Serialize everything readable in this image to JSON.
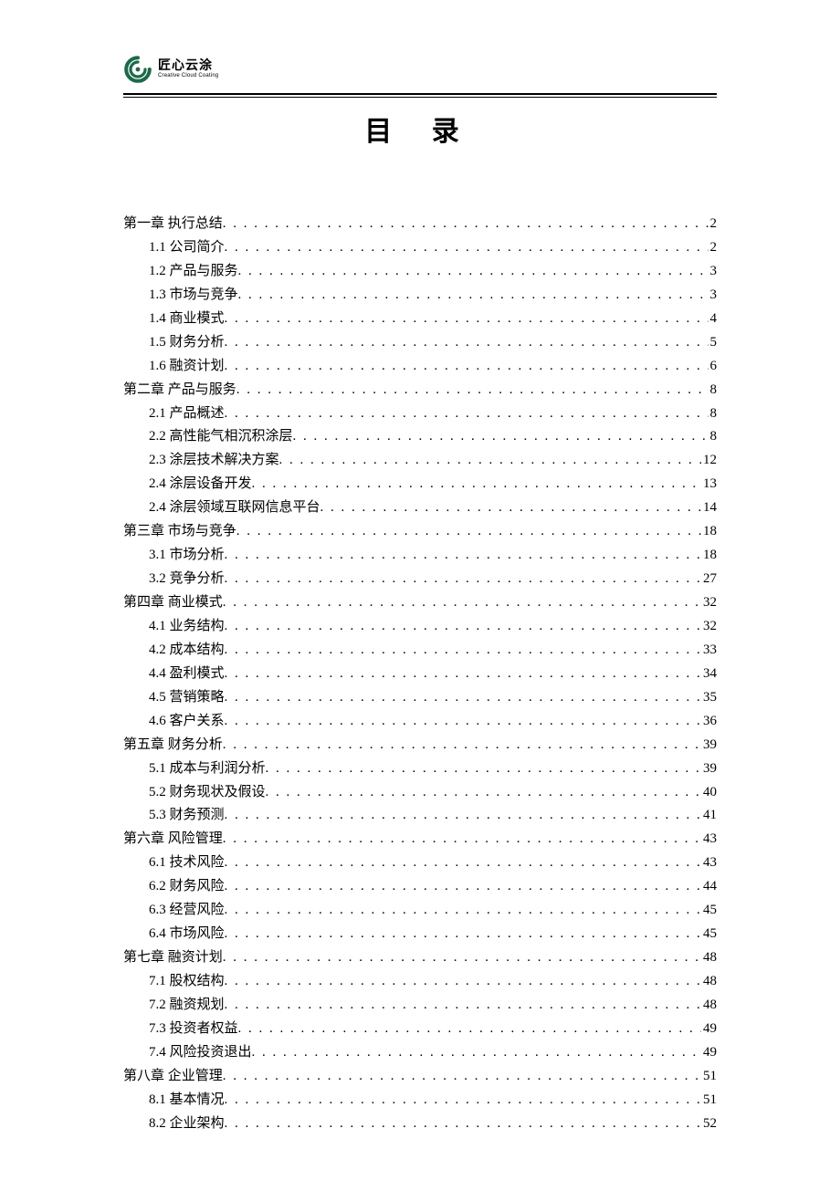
{
  "logo": {
    "chinese": "匠心云涂",
    "english": "Creative Cloud Coating"
  },
  "title": "目  录",
  "toc": [
    {
      "level": "chapter",
      "label": "第一章  执行总结 ",
      "page": "2"
    },
    {
      "level": "sub",
      "label": "1.1  公司简介",
      "page": "2"
    },
    {
      "level": "sub",
      "label": "1.2  产品与服务 ",
      "page": "3"
    },
    {
      "level": "sub",
      "label": "1.3  市场与竞争 ",
      "page": "3"
    },
    {
      "level": "sub",
      "label": "1.4  商业模式",
      "page": "4"
    },
    {
      "level": "sub",
      "label": "1.5  财务分析",
      "page": "5"
    },
    {
      "level": "sub",
      "label": "1.6  融资计划",
      "page": "6"
    },
    {
      "level": "chapter",
      "label": "第二章  产品与服务",
      "page": "8"
    },
    {
      "level": "sub",
      "label": "2.1  产品概述",
      "page": "8"
    },
    {
      "level": "sub",
      "label": "2.2  高性能气相沉积涂层 ",
      "page": "8"
    },
    {
      "level": "sub",
      "label": "2.3  涂层技术解决方案",
      "page": "12"
    },
    {
      "level": "sub",
      "label": "2.4  涂层设备开发",
      "page": "13"
    },
    {
      "level": "sub",
      "label": "2.4  涂层领域互联网信息平台 ",
      "page": "14"
    },
    {
      "level": "chapter",
      "label": "第三章  市场与竞争",
      "page": "18"
    },
    {
      "level": "sub",
      "label": "3.1  市场分析",
      "page": "18"
    },
    {
      "level": "sub",
      "label": "3.2  竞争分析",
      "page": "27"
    },
    {
      "level": "chapter",
      "label": "第四章  商业模式 ",
      "page": "32"
    },
    {
      "level": "sub",
      "label": "4.1  业务结构",
      "page": "32"
    },
    {
      "level": "sub",
      "label": "4.2  成本结构",
      "page": "33"
    },
    {
      "level": "sub",
      "label": "4.4  盈利模式",
      "page": "34"
    },
    {
      "level": "sub",
      "label": "4.5    营销策略",
      "page": "35"
    },
    {
      "level": "sub",
      "label": "4.6  客户关系",
      "page": "36"
    },
    {
      "level": "chapter",
      "label": "第五章  财务分析 ",
      "page": "39"
    },
    {
      "level": "sub",
      "label": "5.1  成本与利润分析 ",
      "page": "39"
    },
    {
      "level": "sub",
      "label": "5.2  财务现状及假设 ",
      "page": "40"
    },
    {
      "level": "sub",
      "label": "5.3  财务预测",
      "page": "41"
    },
    {
      "level": "chapter",
      "label": "第六章  风险管理 ",
      "page": "43"
    },
    {
      "level": "sub",
      "label": "6.1  技术风险",
      "page": "43"
    },
    {
      "level": "sub",
      "label": "6.2  财务风险",
      "page": " 44"
    },
    {
      "level": "sub",
      "label": "6.3  经营风险",
      "page": "45"
    },
    {
      "level": "sub",
      "label": "6.4  市场风险",
      "page": " 45"
    },
    {
      "level": "chapter",
      "label": "第七章  融资计划 ",
      "page": "48"
    },
    {
      "level": "sub",
      "label": "7.1  股权结构",
      "page": "48"
    },
    {
      "level": "sub",
      "label": "7.2  融资规划",
      "page": "48"
    },
    {
      "level": "sub",
      "label": "7.3  投资者权益 ",
      "page": "49"
    },
    {
      "level": "sub",
      "label": "7.4  风险投资退出",
      "page": "49"
    },
    {
      "level": "chapter",
      "label": "第八章  企业管理 ",
      "page": "51"
    },
    {
      "level": "sub",
      "label": "8.1  基本情况",
      "page": "51"
    },
    {
      "level": "sub",
      "label": "8.2  企业架构",
      "page": "52"
    }
  ]
}
